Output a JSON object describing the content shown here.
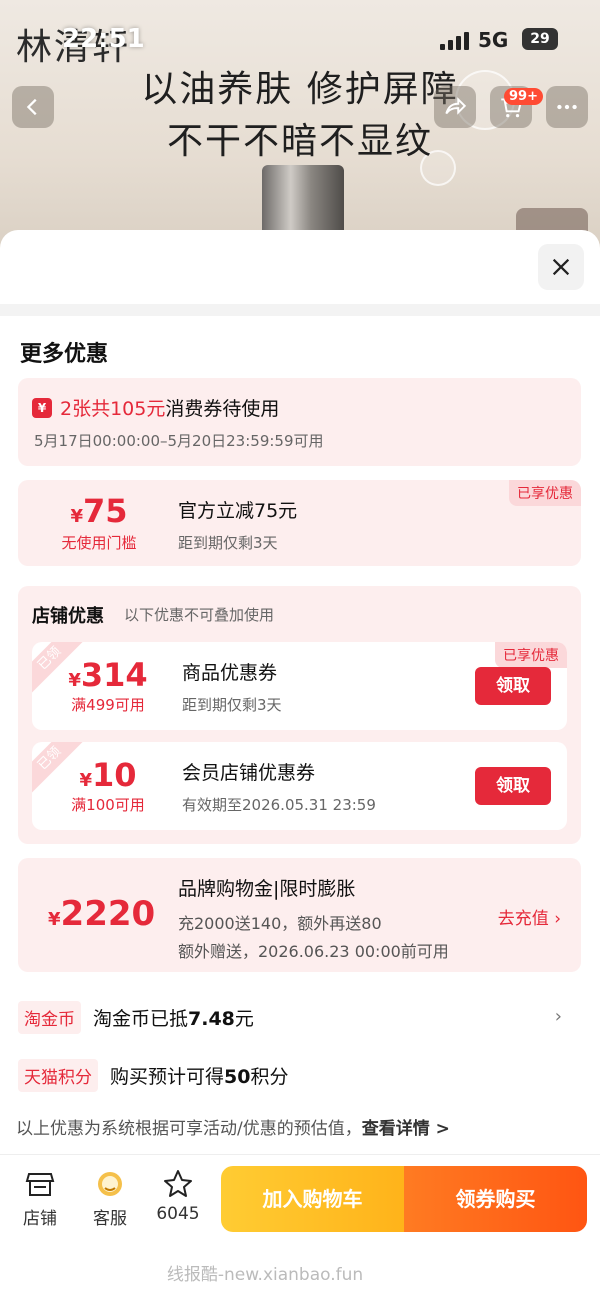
{
  "status_bar": {
    "time": "22:51",
    "network": "5G",
    "battery": "29"
  },
  "banner": {
    "brand": "林清轩",
    "slogan_line1": "以油养肤 修护屏障",
    "slogan_line2": "不干不暗不显纹",
    "cart_badge": "99+"
  },
  "sheet": {
    "title": "更多优惠",
    "voucher_card": {
      "prefix_red": "2张共105元",
      "suffix": "消费券待使用",
      "validity": "5月17日00:00:00–5月20日23:59:59可用"
    },
    "official_card": {
      "currency": "¥",
      "amount": "75",
      "condition": "无使用门槛",
      "title": "官方立减75元",
      "subtitle": "距到期仅剩3天",
      "tag": "已享优惠"
    },
    "store_section": {
      "title": "店铺优惠",
      "note": "以下优惠不可叠加使用",
      "coupons": [
        {
          "corner": "已领",
          "currency": "¥",
          "amount": "314",
          "condition": "满499可用",
          "title": "商品优惠券",
          "subtitle": "距到期仅剩3天",
          "button": "领取",
          "tag": "已享优惠"
        },
        {
          "corner": "已领",
          "currency": "¥",
          "amount": "10",
          "condition": "满100可用",
          "title": "会员店铺优惠券",
          "subtitle": "有效期至2026.05.31 23:59",
          "button": "领取"
        }
      ]
    },
    "gold_card": {
      "currency": "¥",
      "amount": "2220",
      "title": "品牌购物金|限时膨胀",
      "line1": "充2000送140，额外再送80",
      "line2": "额外赠送，2026.06.23 00:00前可用",
      "action": "去充值"
    },
    "taojinbi": {
      "pill": "淘金币",
      "text_prefix": "淘金币已抵",
      "text_value": "7.48",
      "text_suffix": "元"
    },
    "tmall_points": {
      "pill": "天猫积分",
      "text_prefix": "购买预计可得",
      "text_value": "50",
      "text_suffix": "积分"
    },
    "disclaimer_prefix": "以上优惠为系统根据可享活动/优惠的预估值，",
    "disclaimer_link": "查看详情 >"
  },
  "bottom_bar": {
    "shop_label": "店铺",
    "cs_label": "客服",
    "fav_count": "6045",
    "add_cart": "加入购物车",
    "buy": "领券购买"
  },
  "watermark": "线报酷-new.xianbao.fun",
  "colors": {
    "accent_red": "#e5293a",
    "cart_yellow": "#ffb31a",
    "buy_orange": "#ff5512"
  }
}
